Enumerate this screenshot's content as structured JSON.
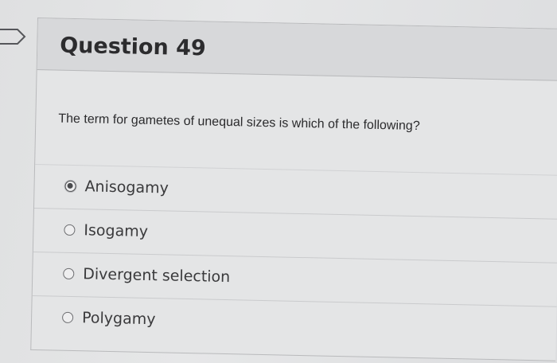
{
  "question": {
    "title": "Question 49",
    "text": "The term for gametes of unequal sizes is which of the following?"
  },
  "answers": [
    {
      "label": "Anisogamy",
      "selected": true
    },
    {
      "label": "Isogamy",
      "selected": false
    },
    {
      "label": "Divergent selection",
      "selected": false
    },
    {
      "label": "Polygamy",
      "selected": false
    }
  ],
  "icons": {
    "flag": "flag-outline-icon"
  }
}
